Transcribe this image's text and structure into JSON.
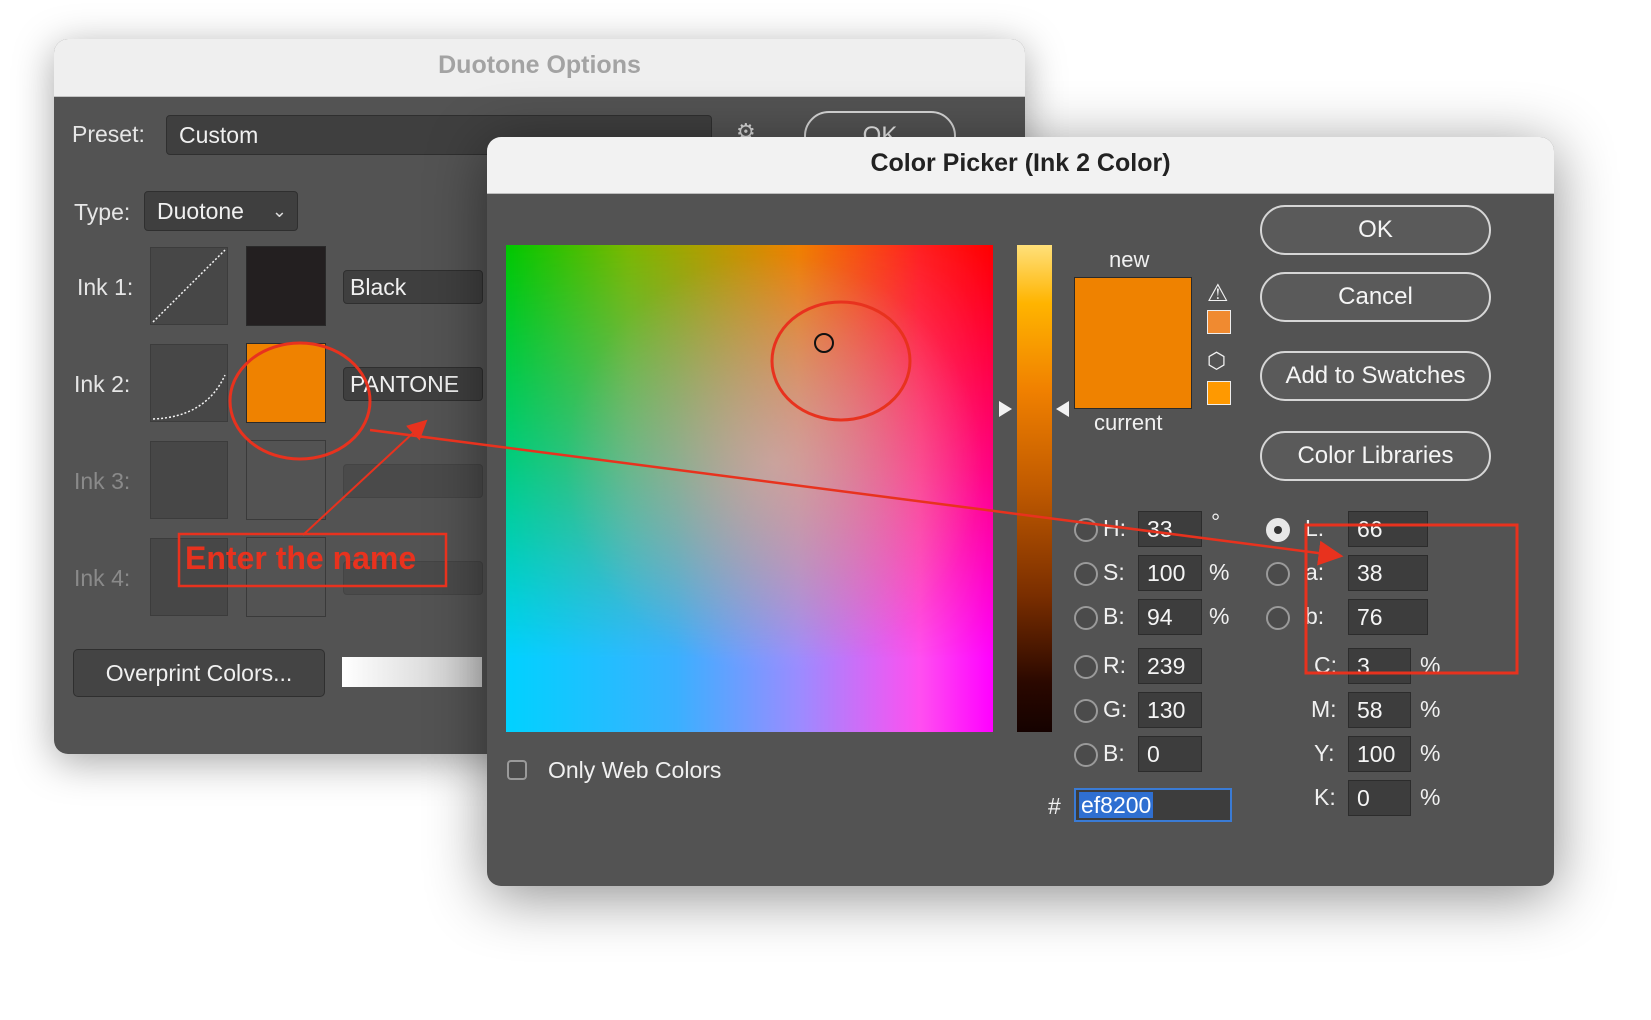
{
  "duotone": {
    "title": "Duotone Options",
    "preset_label": "Preset:",
    "preset_value": "Custom",
    "ok_label": "OK",
    "type_label": "Type:",
    "type_value": "Duotone",
    "inks": [
      {
        "label": "Ink 1:",
        "name": "Black",
        "color": "#231f20"
      },
      {
        "label": "Ink 2:",
        "name": "PANTONE",
        "color": "#ef8200"
      },
      {
        "label": "Ink 3:",
        "name": ""
      },
      {
        "label": "Ink 4:",
        "name": ""
      }
    ],
    "overprint_label": "Overprint Colors..."
  },
  "annotation": {
    "text": "Enter the name",
    "color": "#e8321e"
  },
  "picker": {
    "title": "Color Picker (Ink 2 Color)",
    "buttons": {
      "ok": "OK",
      "cancel": "Cancel",
      "add_to_swatches": "Add to Swatches",
      "color_libraries": "Color Libraries"
    },
    "preview": {
      "new_label": "new",
      "current_label": "current",
      "new_color": "#ef8200",
      "current_color": "#ef8200",
      "gamut_warning_color": "#f08a30",
      "web_safe_color": "#ff9900"
    },
    "hsb": {
      "h_label": "H:",
      "h_value": "33",
      "h_unit": "°",
      "s_label": "S:",
      "s_value": "100",
      "s_unit": "%",
      "b_label": "B:",
      "b_value": "94",
      "b_unit": "%"
    },
    "rgb": {
      "r_label": "R:",
      "r_value": "239",
      "g_label": "G:",
      "g_value": "130",
      "b_label": "B:",
      "b_value": "0"
    },
    "lab": {
      "l_label": "L:",
      "l_value": "66",
      "a_label": "a:",
      "a_value": "38",
      "b_label": "b:",
      "b_value": "76"
    },
    "cmyk": {
      "c_label": "C:",
      "c_value": "3",
      "m_label": "M:",
      "m_value": "58",
      "y_label": "Y:",
      "y_value": "100",
      "k_label": "K:",
      "k_value": "0",
      "unit": "%"
    },
    "hex_label": "#",
    "hex_value": "ef8200",
    "only_web_colors_label": "Only Web Colors"
  }
}
